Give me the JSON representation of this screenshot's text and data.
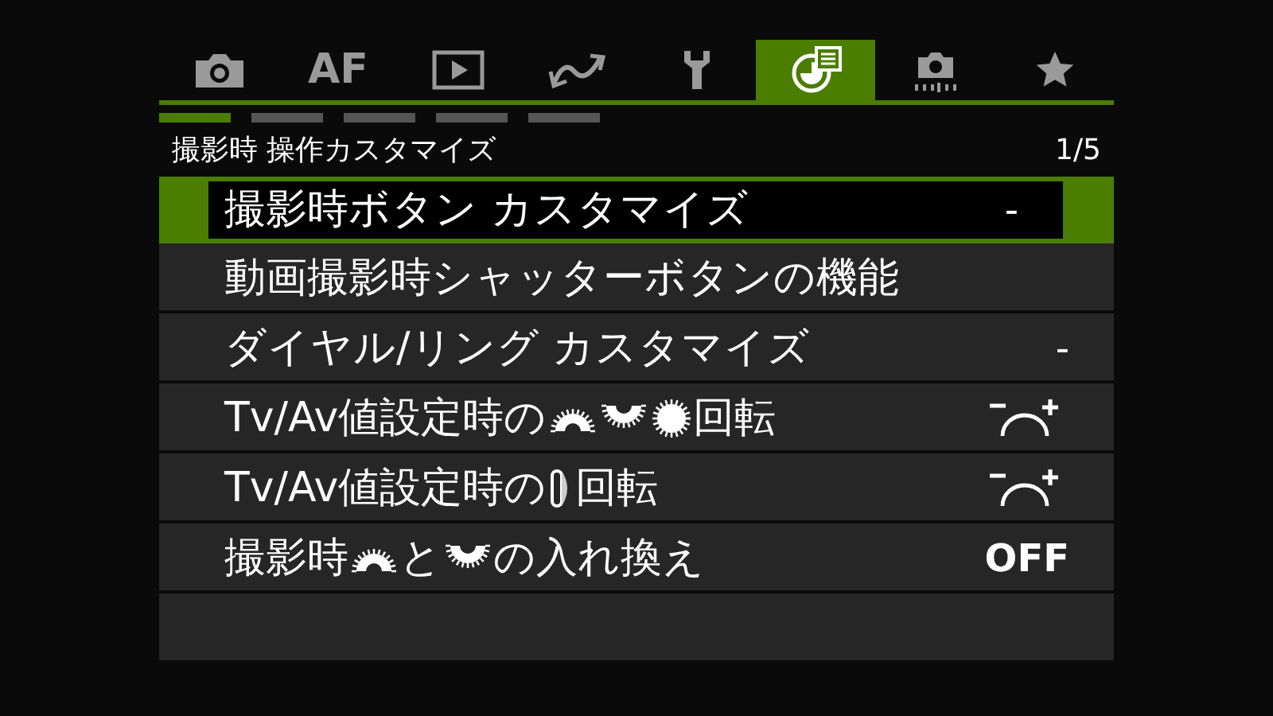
{
  "tabs": [
    {
      "kind": "camera",
      "selected": false
    },
    {
      "kind": "text",
      "text": "AF",
      "selected": false
    },
    {
      "kind": "play",
      "selected": false
    },
    {
      "kind": "wave",
      "selected": false
    },
    {
      "kind": "wrench",
      "selected": false
    },
    {
      "kind": "custom",
      "selected": true
    },
    {
      "kind": "camera-dots",
      "selected": false
    },
    {
      "kind": "star",
      "selected": false
    }
  ],
  "pages": [
    {
      "selected": true
    },
    {
      "selected": false
    },
    {
      "selected": false
    },
    {
      "selected": false
    },
    {
      "selected": false
    }
  ],
  "header": {
    "title": "撮影時 操作カスタマイズ",
    "page": "1/5"
  },
  "items": [
    {
      "selected": true,
      "parts": [
        {
          "kind": "text",
          "text": "撮影時ボタン カスタマイズ"
        }
      ],
      "value": {
        "kind": "text",
        "text": "-"
      }
    },
    {
      "selected": false,
      "parts": [
        {
          "kind": "text",
          "text": "動画撮影時シャッターボタンの機能"
        }
      ]
    },
    {
      "selected": false,
      "parts": [
        {
          "kind": "text",
          "text": "ダイヤル/リング カスタマイズ"
        }
      ],
      "value": {
        "kind": "text",
        "text": "-"
      }
    },
    {
      "selected": false,
      "parts": [
        {
          "kind": "text",
          "text": "Tv/Av値設定時の"
        },
        {
          "kind": "top-dial"
        },
        {
          "kind": "bottom-dial"
        },
        {
          "kind": "round-dial"
        },
        {
          "kind": "text",
          "text": "回転"
        }
      ],
      "value": {
        "kind": "direction"
      }
    },
    {
      "selected": false,
      "parts": [
        {
          "kind": "text",
          "text": "Tv/Av値設定時の"
        },
        {
          "kind": "ring"
        },
        {
          "kind": "text",
          "text": "回転"
        }
      ],
      "value": {
        "kind": "direction"
      }
    },
    {
      "selected": false,
      "parts": [
        {
          "kind": "text",
          "text": "撮影時"
        },
        {
          "kind": "top-dial"
        },
        {
          "kind": "text",
          "text": "と"
        },
        {
          "kind": "bottom-dial"
        },
        {
          "kind": "text",
          "text": "の入れ換え"
        }
      ],
      "value": {
        "kind": "text",
        "text": "OFF",
        "bold": true
      }
    }
  ]
}
